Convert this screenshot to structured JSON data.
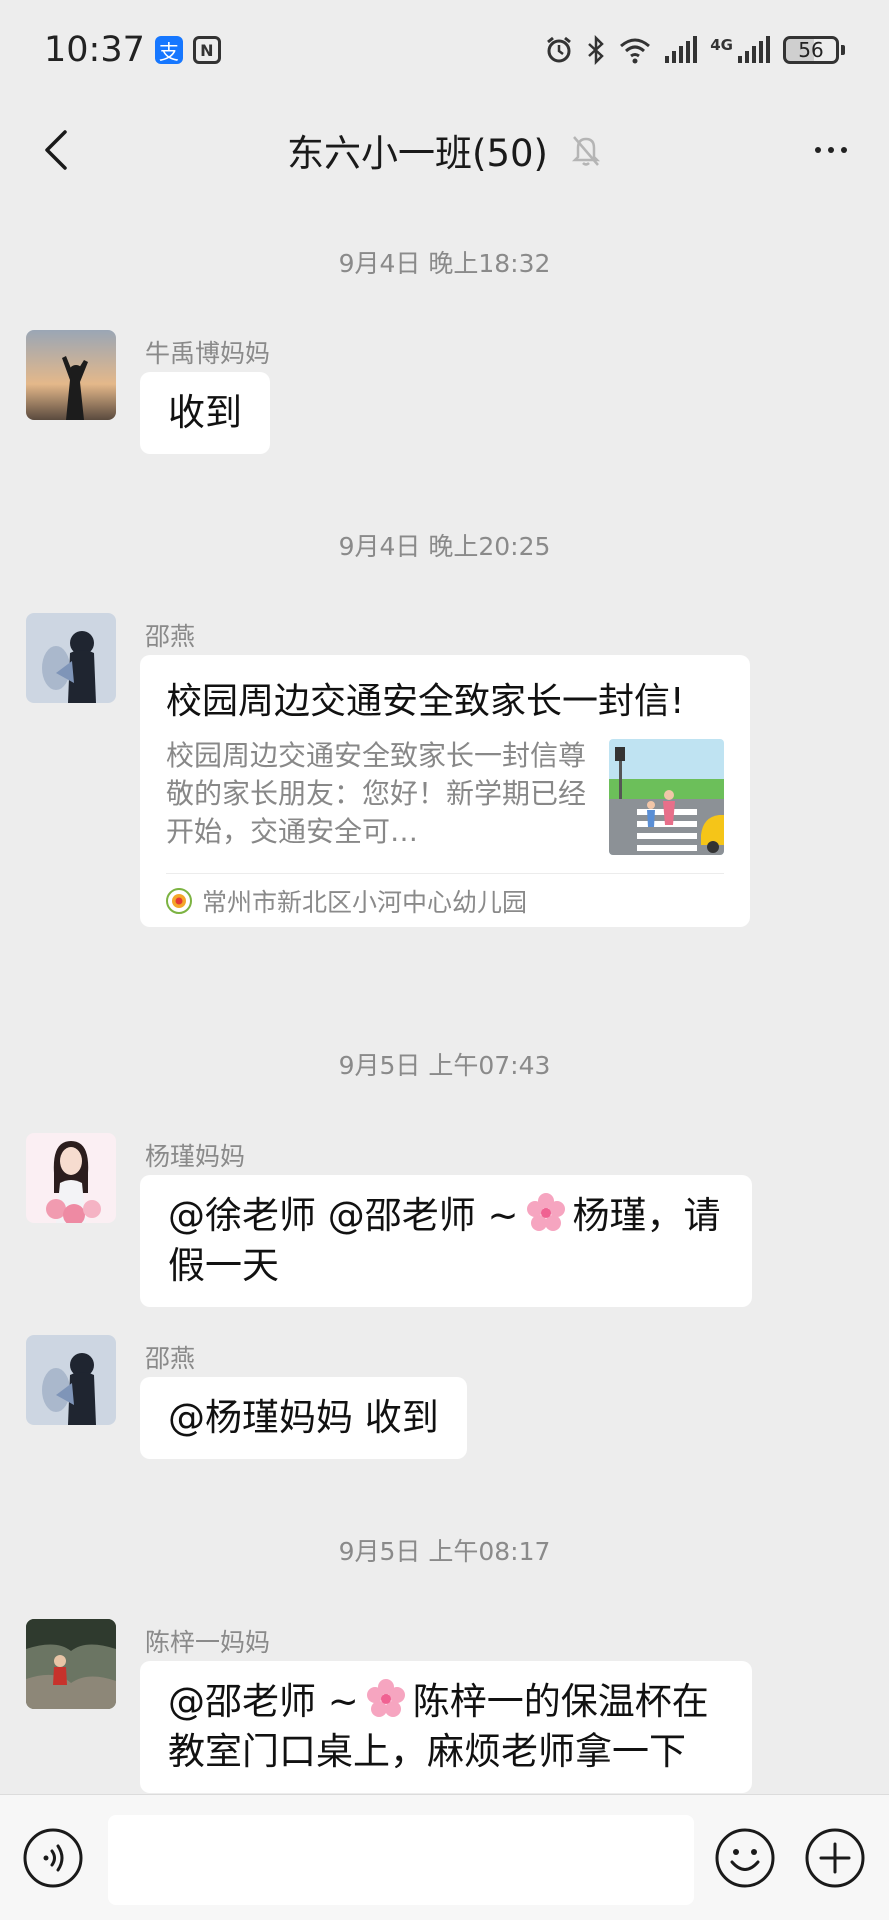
{
  "status_bar": {
    "time": "10:37",
    "alipay_glyph": "支",
    "nfc_glyph": "N",
    "network_label": "4G",
    "battery": "56"
  },
  "nav": {
    "title": "东六小一班(50)",
    "back_icon": "chevron-left-icon",
    "more_icon": "more-dots-icon",
    "mute_icon": "bell-muted-icon"
  },
  "messages": [
    {
      "type": "time",
      "text": "9月4日 晚上18:32"
    },
    {
      "type": "text",
      "sender": "牛禹博妈妈",
      "text": "收到"
    },
    {
      "type": "time",
      "text": "9月4日 晚上20:25"
    },
    {
      "type": "link",
      "sender": "邵燕",
      "title": "校园周边交通安全致家长一封信!",
      "description": "校园周边交通安全致家长一封信尊敬的家长朋友：您好！新学期已经开始，交通安全可…",
      "source": "常州市新北区小河中心幼儿园"
    },
    {
      "type": "time",
      "text": "9月5日 上午07:43"
    },
    {
      "type": "text",
      "sender": "杨瑾妈妈",
      "line1_a": "@徐老师 @邵老师 ~",
      "line1_b": "杨瑾，请",
      "line2": "假一天"
    },
    {
      "type": "text",
      "sender": "邵燕",
      "text": "@杨瑾妈妈  收到"
    },
    {
      "type": "time",
      "text": "9月5日 上午08:17"
    },
    {
      "type": "text",
      "sender": "陈梓一妈妈",
      "line1_a": "@邵老师 ~",
      "line1_b": "陈梓一的保温杯在",
      "line2": "教室门口桌上，麻烦老师拿一下"
    }
  ],
  "input_bar": {
    "voice_icon": "voice-icon",
    "emoji_icon": "emoji-icon",
    "plus_icon": "plus-icon",
    "placeholder": ""
  },
  "colors": {
    "background": "#ededed",
    "bubble": "#ffffff",
    "muted_text": "#8a8a8a"
  }
}
